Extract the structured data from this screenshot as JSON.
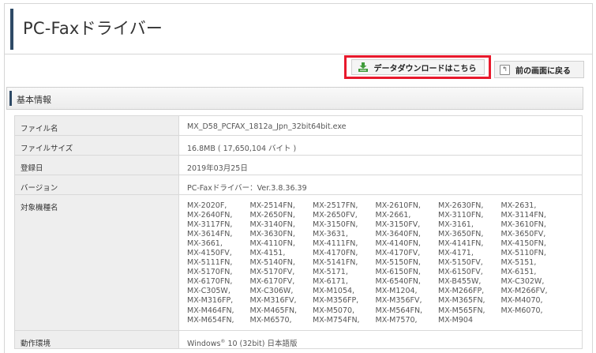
{
  "header": {
    "title": "PC-Faxドライバー"
  },
  "buttons": {
    "download_label": "データダウンロードはこちら",
    "back_label": "前の画面に戻る"
  },
  "section": {
    "title": "基本情報"
  },
  "info": {
    "file_name": {
      "label": "ファイル名",
      "value": "MX_D58_PCFAX_1812a_Jpn_32bit64bit.exe"
    },
    "file_size": {
      "label": "ファイルサイズ",
      "value": "16.8MB ( 17,650,104 バイト )"
    },
    "date": {
      "label": "登録日",
      "value": "2019年03月25日"
    },
    "version": {
      "label": "バージョン",
      "value": "PC-Faxドライバー：Ver.3.8.36.39"
    },
    "models_label": "対象機種名",
    "models": [
      "MX-2020F,",
      "MX-2514FN,",
      "MX-2517FN,",
      "MX-2610FN,",
      "MX-2630FN,",
      "MX-2631,",
      "MX-2640FN,",
      "MX-2650FN,",
      "MX-2650FV,",
      "MX-2661,",
      "MX-3110FN,",
      "MX-3114FN,",
      "MX-3117FN,",
      "MX-3140FN,",
      "MX-3150FN,",
      "MX-3150FV,",
      "MX-3161,",
      "MX-3610FN,",
      "MX-3614FN,",
      "MX-3630FN,",
      "MX-3631,",
      "MX-3640FN,",
      "MX-3650FN,",
      "MX-3650FV,",
      "MX-3661,",
      "MX-4110FN,",
      "MX-4111FN,",
      "MX-4140FN,",
      "MX-4141FN,",
      "MX-4150FN,",
      "MX-4150FV,",
      "MX-4151,",
      "MX-4170FN,",
      "MX-4170FV,",
      "MX-4171,",
      "MX-5110FN,",
      "MX-5111FN,",
      "MX-5140FN,",
      "MX-5141FN,",
      "MX-5150FN,",
      "MX-5150FV,",
      "MX-5151,",
      "MX-5170FN,",
      "MX-5170FV,",
      "MX-5171,",
      "MX-6150FN,",
      "MX-6150FV,",
      "MX-6151,",
      "MX-6170FN,",
      "MX-6170FV,",
      "MX-6171,",
      "MX-6540FN,",
      "MX-B455W,",
      "MX-C302W,",
      "MX-C305W,",
      "MX-C306W,",
      "MX-M1054,",
      "MX-M1204,",
      "MX-M266FP,",
      "MX-M266FV,",
      "MX-M316FP,",
      "MX-M316FV,",
      "MX-M356FP,",
      "MX-M356FV,",
      "MX-M365FN,",
      "MX-M4070,",
      "MX-M464FN,",
      "MX-M465FN,",
      "MX-M5070,",
      "MX-M564FN,",
      "MX-M565FN,",
      "MX-M6070,",
      "MX-M654FN,",
      "MX-M6570,",
      "MX-M754FN,",
      "MX-M7570,",
      "MX-M904",
      ""
    ],
    "env": {
      "label": "動作環境",
      "value_prefix": "Windows",
      "value_sup": "®",
      "value_suffix": " 10 (32bit) 日本語版"
    }
  }
}
